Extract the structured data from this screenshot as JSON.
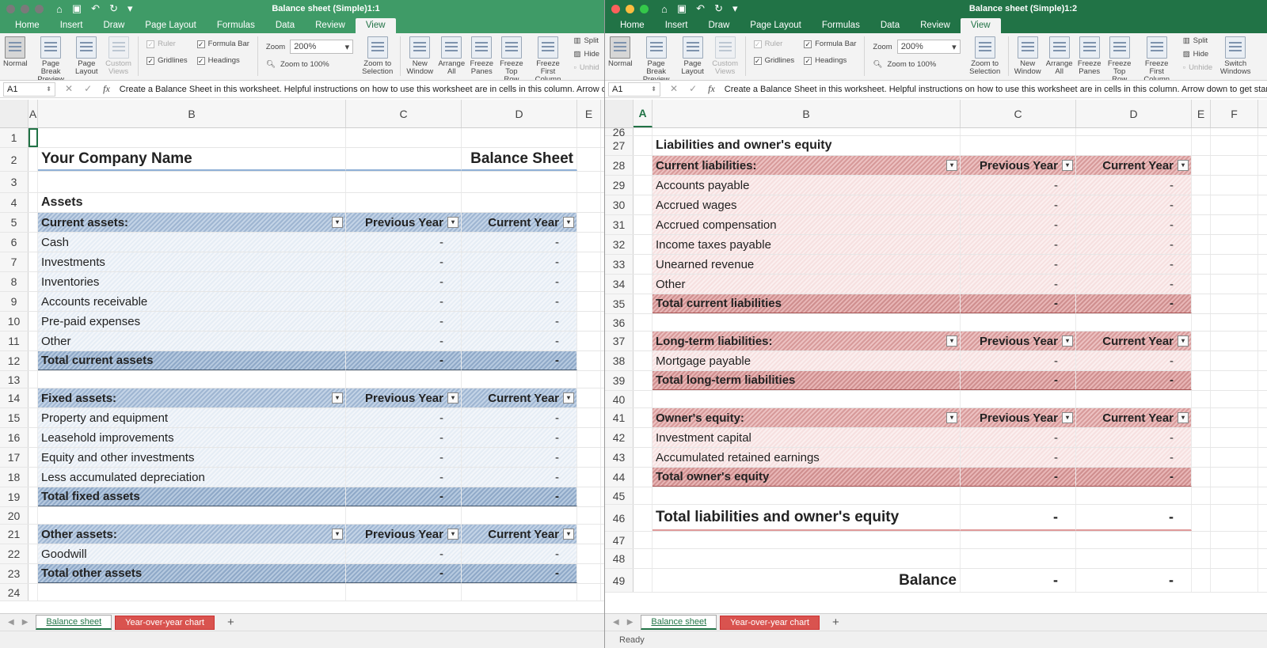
{
  "ribbon": {
    "tabs": [
      "Home",
      "Insert",
      "Draw",
      "Page Layout",
      "Formulas",
      "Data",
      "Review",
      "View"
    ],
    "active_tab": "View",
    "views": [
      "Normal",
      "Page Break Preview",
      "Page Layout",
      "Custom Views"
    ],
    "checks": {
      "ruler": "Ruler",
      "formula_bar": "Formula Bar",
      "gridlines": "Gridlines",
      "headings": "Headings"
    },
    "zoom_label": "Zoom",
    "zoom_value": "200%",
    "zoom_100": "Zoom to 100%",
    "zoom_sel": "Zoom to Selection",
    "window_btns": [
      "New Window",
      "Arrange All",
      "Freeze Panes",
      "Freeze Top Row",
      "Freeze First Column"
    ],
    "split": "Split",
    "hide": "Hide",
    "unhide": "Unhide",
    "switch": "Switch Windows"
  },
  "formula": {
    "cell": "A1",
    "text": "Create a Balance Sheet in this worksheet. Helpful instructions on how to use this worksheet are in cells in this column. Arrow down to get started."
  },
  "w1": {
    "title": "Balance sheet (Simple)1:1",
    "unhide_trunc": "Unhid",
    "formula_trunc": "Create a Balance Sheet in this worksheet. Helpful instructions on how to use this worksheet are in cells in this column. Arrow dow",
    "cols": [
      "A",
      "B",
      "C",
      "D",
      "E"
    ],
    "company": "Your Company Name",
    "sheet_title": "Balance Sheet",
    "assets": "Assets",
    "prev": "Previous Year",
    "curr": "Current Year",
    "dash": "-",
    "current_hdr": "Current assets:",
    "current_items": [
      "Cash",
      "Investments",
      "Inventories",
      "Accounts receivable",
      "Pre-paid expenses",
      "Other"
    ],
    "current_total": "Total current assets",
    "fixed_hdr": "Fixed assets:",
    "fixed_items": [
      "Property and equipment",
      "Leasehold improvements",
      "Equity and other investments",
      "Less accumulated depreciation"
    ],
    "fixed_total": "Total fixed assets",
    "other_hdr": "Other assets:",
    "other_items": [
      "Goodwill"
    ],
    "other_total": "Total other assets"
  },
  "w2": {
    "title": "Balance sheet (Simple)1:2",
    "cols": [
      "A",
      "B",
      "C",
      "D",
      "E",
      "F"
    ],
    "liab_title": "Liabilities and owner's equity",
    "cl_hdr": "Current liabilities:",
    "cl_items": [
      "Accounts payable",
      "Accrued wages",
      "Accrued compensation",
      "Income taxes payable",
      "Unearned revenue",
      "Other"
    ],
    "cl_total": "Total current liabilities",
    "lt_hdr": "Long-term liabilities:",
    "lt_items": [
      "Mortgage payable"
    ],
    "lt_total": "Total long-term liabilities",
    "oe_hdr": "Owner's equity:",
    "oe_items": [
      "Investment capital",
      "Accumulated retained earnings"
    ],
    "oe_total": "Total owner's equity",
    "grand_total": "Total liabilities and owner's equity",
    "balance": "Balance",
    "status": "Ready"
  },
  "sheets": [
    "Balance sheet",
    "Year-over-year chart"
  ]
}
